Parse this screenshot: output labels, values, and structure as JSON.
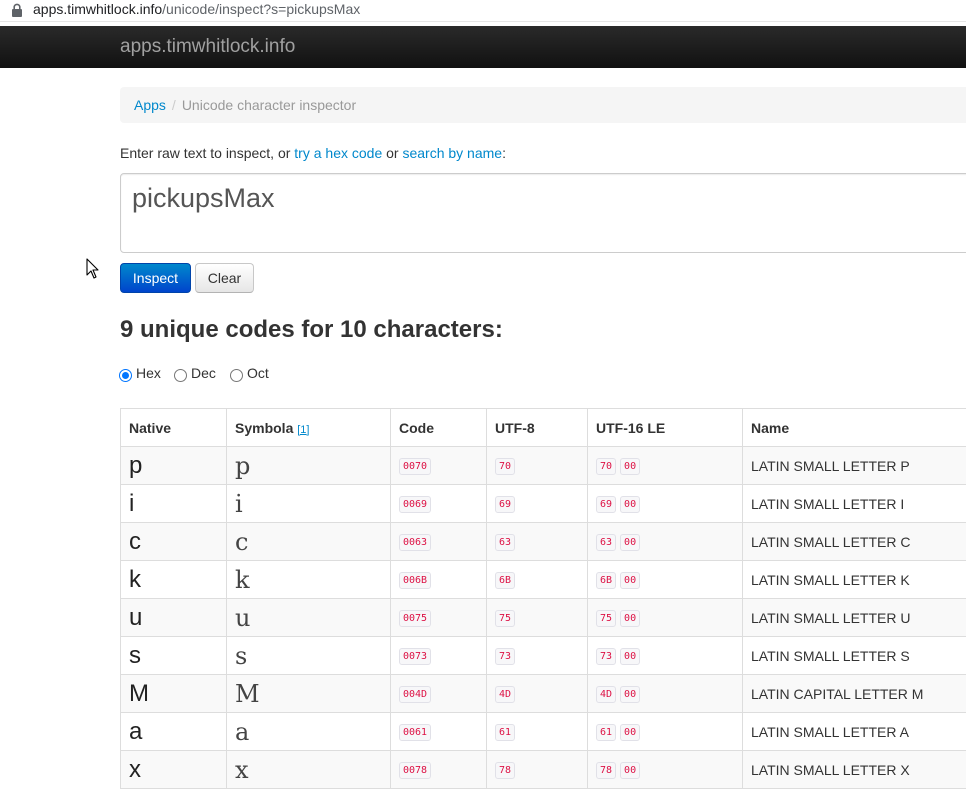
{
  "browser": {
    "url_host": "apps.timwhitlock.info",
    "url_path": "/unicode/inspect?s=pickupsMax"
  },
  "navbar": {
    "brand": "apps.timwhitlock.info"
  },
  "breadcrumb": {
    "home": "Apps",
    "separator": "/",
    "current": "Unicode character inspector"
  },
  "intro": {
    "prefix": "Enter raw text to inspect, or ",
    "hex_link": "try a hex code",
    "middle": " or ",
    "name_link": "search by name",
    "suffix": ":"
  },
  "input": {
    "value": "pickupsMax"
  },
  "buttons": {
    "inspect": "Inspect",
    "clear": "Clear"
  },
  "heading": "9 unique codes for 10 characters:",
  "radios": {
    "hex": "Hex",
    "dec": "Dec",
    "oct": "Oct",
    "selected": "Hex"
  },
  "table": {
    "headers": {
      "native": "Native",
      "symbola": "Symbola",
      "symbola_ref": "[1]",
      "code": "Code",
      "utf8": "UTF-8",
      "utf16": "UTF-16 LE",
      "name": "Name"
    },
    "rows": [
      {
        "native": "p",
        "symbola": "p",
        "code": "0070",
        "utf8": "70",
        "utf16_a": "70",
        "utf16_b": "00",
        "name": "LATIN SMALL LETTER P"
      },
      {
        "native": "i",
        "symbola": "i",
        "code": "0069",
        "utf8": "69",
        "utf16_a": "69",
        "utf16_b": "00",
        "name": "LATIN SMALL LETTER I"
      },
      {
        "native": "c",
        "symbola": "c",
        "code": "0063",
        "utf8": "63",
        "utf16_a": "63",
        "utf16_b": "00",
        "name": "LATIN SMALL LETTER C"
      },
      {
        "native": "k",
        "symbola": "k",
        "code": "006B",
        "utf8": "6B",
        "utf16_a": "6B",
        "utf16_b": "00",
        "name": "LATIN SMALL LETTER K"
      },
      {
        "native": "u",
        "symbola": "u",
        "code": "0075",
        "utf8": "75",
        "utf16_a": "75",
        "utf16_b": "00",
        "name": "LATIN SMALL LETTER U"
      },
      {
        "native": "s",
        "symbola": "s",
        "code": "0073",
        "utf8": "73",
        "utf16_a": "73",
        "utf16_b": "00",
        "name": "LATIN SMALL LETTER S"
      },
      {
        "native": "M",
        "symbola": "M",
        "code": "004D",
        "utf8": "4D",
        "utf16_a": "4D",
        "utf16_b": "00",
        "name": "LATIN CAPITAL LETTER M"
      },
      {
        "native": "a",
        "symbola": "a",
        "code": "0061",
        "utf8": "61",
        "utf16_a": "61",
        "utf16_b": "00",
        "name": "LATIN SMALL LETTER A"
      },
      {
        "native": "x",
        "symbola": "x",
        "code": "0078",
        "utf8": "78",
        "utf16_a": "78",
        "utf16_b": "00",
        "name": "LATIN SMALL LETTER X"
      }
    ]
  },
  "colors": {
    "link": "#0088cc",
    "navbar_bg": "#1b1b1b",
    "primary_button": "#0055cc",
    "code_text": "#dd1144"
  },
  "icons": {
    "lock": "lock-icon",
    "cursor": "mouse-pointer-icon"
  }
}
